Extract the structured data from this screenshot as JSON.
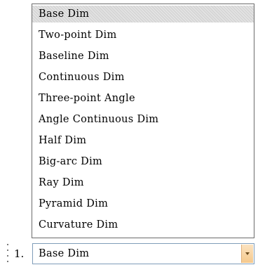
{
  "dropdown": {
    "selected_index": 0,
    "items": [
      {
        "label": "Base Dim"
      },
      {
        "label": "Two-point Dim"
      },
      {
        "label": "Baseline Dim"
      },
      {
        "label": "Continuous Dim"
      },
      {
        "label": "Three-point Angle"
      },
      {
        "label": "Angle Continuous Dim"
      },
      {
        "label": "Half Dim"
      },
      {
        "label": "Big-arc Dim"
      },
      {
        "label": "Ray Dim"
      },
      {
        "label": "Pyramid Dim"
      },
      {
        "label": "Curvature Dim"
      }
    ]
  },
  "toolbar": {
    "step_label": "1.",
    "combo_value": "Base Dim"
  },
  "colors": {
    "selection_background": "#d6d6d6",
    "combo_arrow_accent": "#f5c98c"
  },
  "icons": {
    "grip": "toolbar-grip-icon",
    "arrow": "chevron-down-icon"
  }
}
